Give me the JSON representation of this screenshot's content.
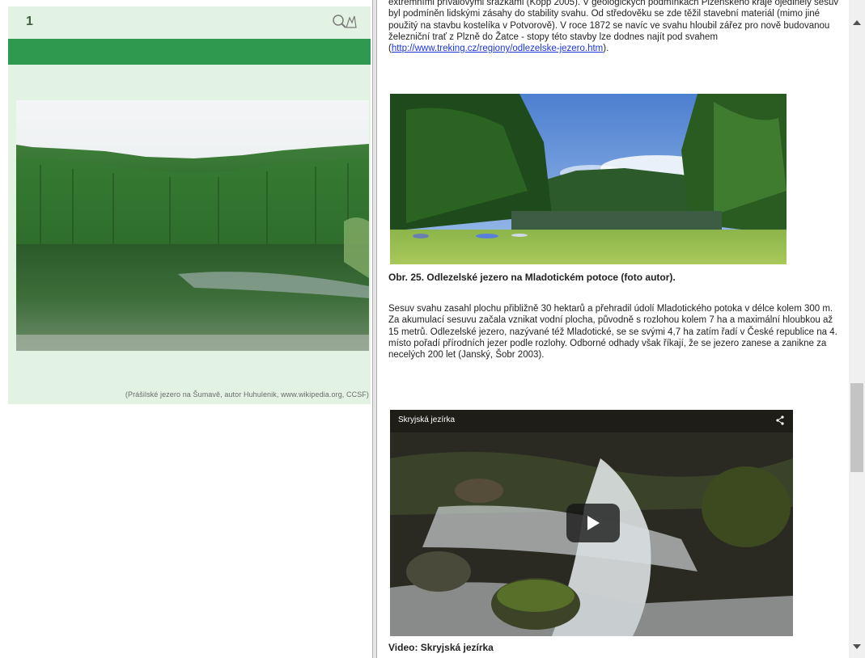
{
  "left_panel": {
    "page_number": "1",
    "tools_icon": "search-tools-icon",
    "photo_caption": "(Prášilské jezero na Šumavě, autor Huhulenik, www.wikipedia.org, CCSF)"
  },
  "right_panel": {
    "para1_text": "extrémními přívalovými srážkami (Kopp 2005). V geologických podmínkách Plzeňského kraje ojedinělý sesuv byl podmíněn lidskými zásahy do stability svahu. Od středověku se zde těžil stavební materiál (mimo jiné použitý na stavbu kostelíka v Potvorově). V roce 1872 se navíc ve svahu hloubil zářez pro nově budovanou železniční trať z Plzně do Žatce - stopy této stavby lze dodnes najít pod svahem (",
    "para1_link": "http://www.treking.cz/regiony/odlezelske-jezero.htm",
    "para1_end": ").",
    "figure_caption": "Obr. 25. Odlezelské jezero na Mladotickém potoce (foto autor).",
    "para2_text": "Sesuv svahu zasahl plochu přibližně 30 hektarů a přehradil údolí Mladotického potoka v délce kolem 300 m. Za akumulací sesuvu začala vznikat vodní plocha, původně s rozlohou kolem 7 ha a maximální hloubkou až 15 metrů. Odlezelské jezero, nazývané též Mladotické, se se svými 4,7 ha zatím řadí v České republice na 4. místo pořadí přírodních jezer podle rozlohy. Odborné odhady však říkají, že se jezero zanese a zanikne za necelých 200 let (Janský, Šobr 2003).",
    "video_title": "Skryjská jezírka",
    "video_caption": "Video:  Skryjská jezírka"
  },
  "colors": {
    "green_bar": "#2f9a4f",
    "card_bg": "#e2f3e3",
    "link": "#1a36d6"
  }
}
